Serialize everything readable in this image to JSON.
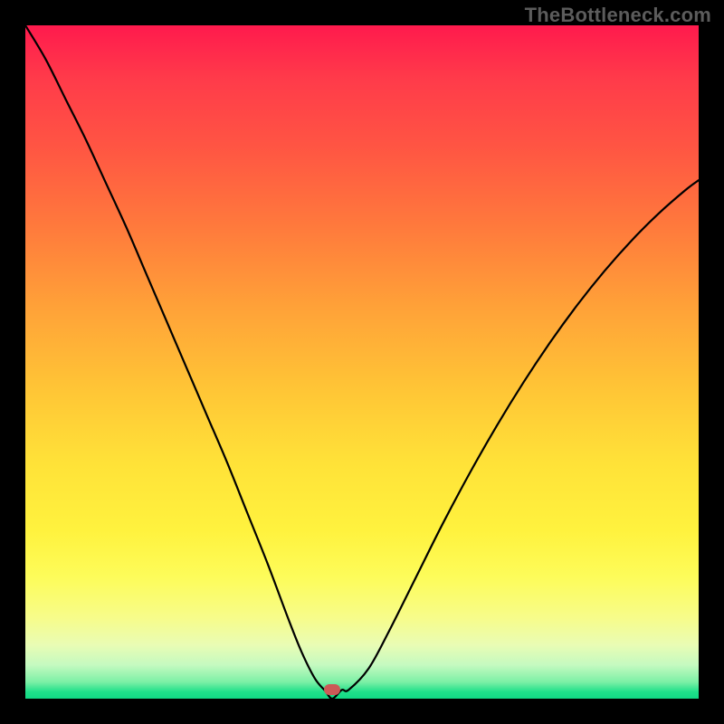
{
  "watermark": {
    "text": "TheBottleneck.com"
  },
  "colors": {
    "gradient_top": "#ff1a4d",
    "gradient_bottom": "#11d884",
    "curve": "#000000",
    "marker": "#cc5a57",
    "frame": "#000000"
  },
  "marker": {
    "x_frac_plot": 0.456,
    "y_frac_plot": 0.987
  },
  "chart_data": {
    "type": "line",
    "title": "",
    "xlabel": "",
    "ylabel": "",
    "xlim": [
      0,
      100
    ],
    "ylim": [
      0,
      100
    ],
    "grid": false,
    "legend": false,
    "description": "V-shaped bottleneck curve. Background vertical gradient from red (high) through yellow to green (low). Black curve descends from top-left to a minimum near x≈45.6% then rises toward upper-right. Small red rounded marker sits at the minimum on the green band.",
    "x": [
      0,
      3,
      6,
      9,
      12,
      15,
      18,
      21,
      24,
      27,
      30,
      33,
      36,
      39,
      41,
      43,
      44.5,
      45.6,
      47,
      48,
      51,
      54,
      58,
      62,
      66,
      70,
      74,
      78,
      82,
      86,
      90,
      94,
      98,
      100
    ],
    "values": [
      100,
      95,
      89,
      83,
      76.5,
      70,
      63,
      56,
      49,
      42,
      35,
      27.5,
      20,
      12,
      7,
      3,
      1.2,
      0,
      1.3,
      1.3,
      4.5,
      10,
      18,
      26,
      33.5,
      40.5,
      47,
      53,
      58.5,
      63.5,
      68,
      72,
      75.5,
      77
    ],
    "marker_point": {
      "x": 45.6,
      "y": 0
    },
    "annotations": [
      {
        "text": "TheBottleneck.com",
        "role": "watermark",
        "position": "top-right"
      }
    ]
  }
}
